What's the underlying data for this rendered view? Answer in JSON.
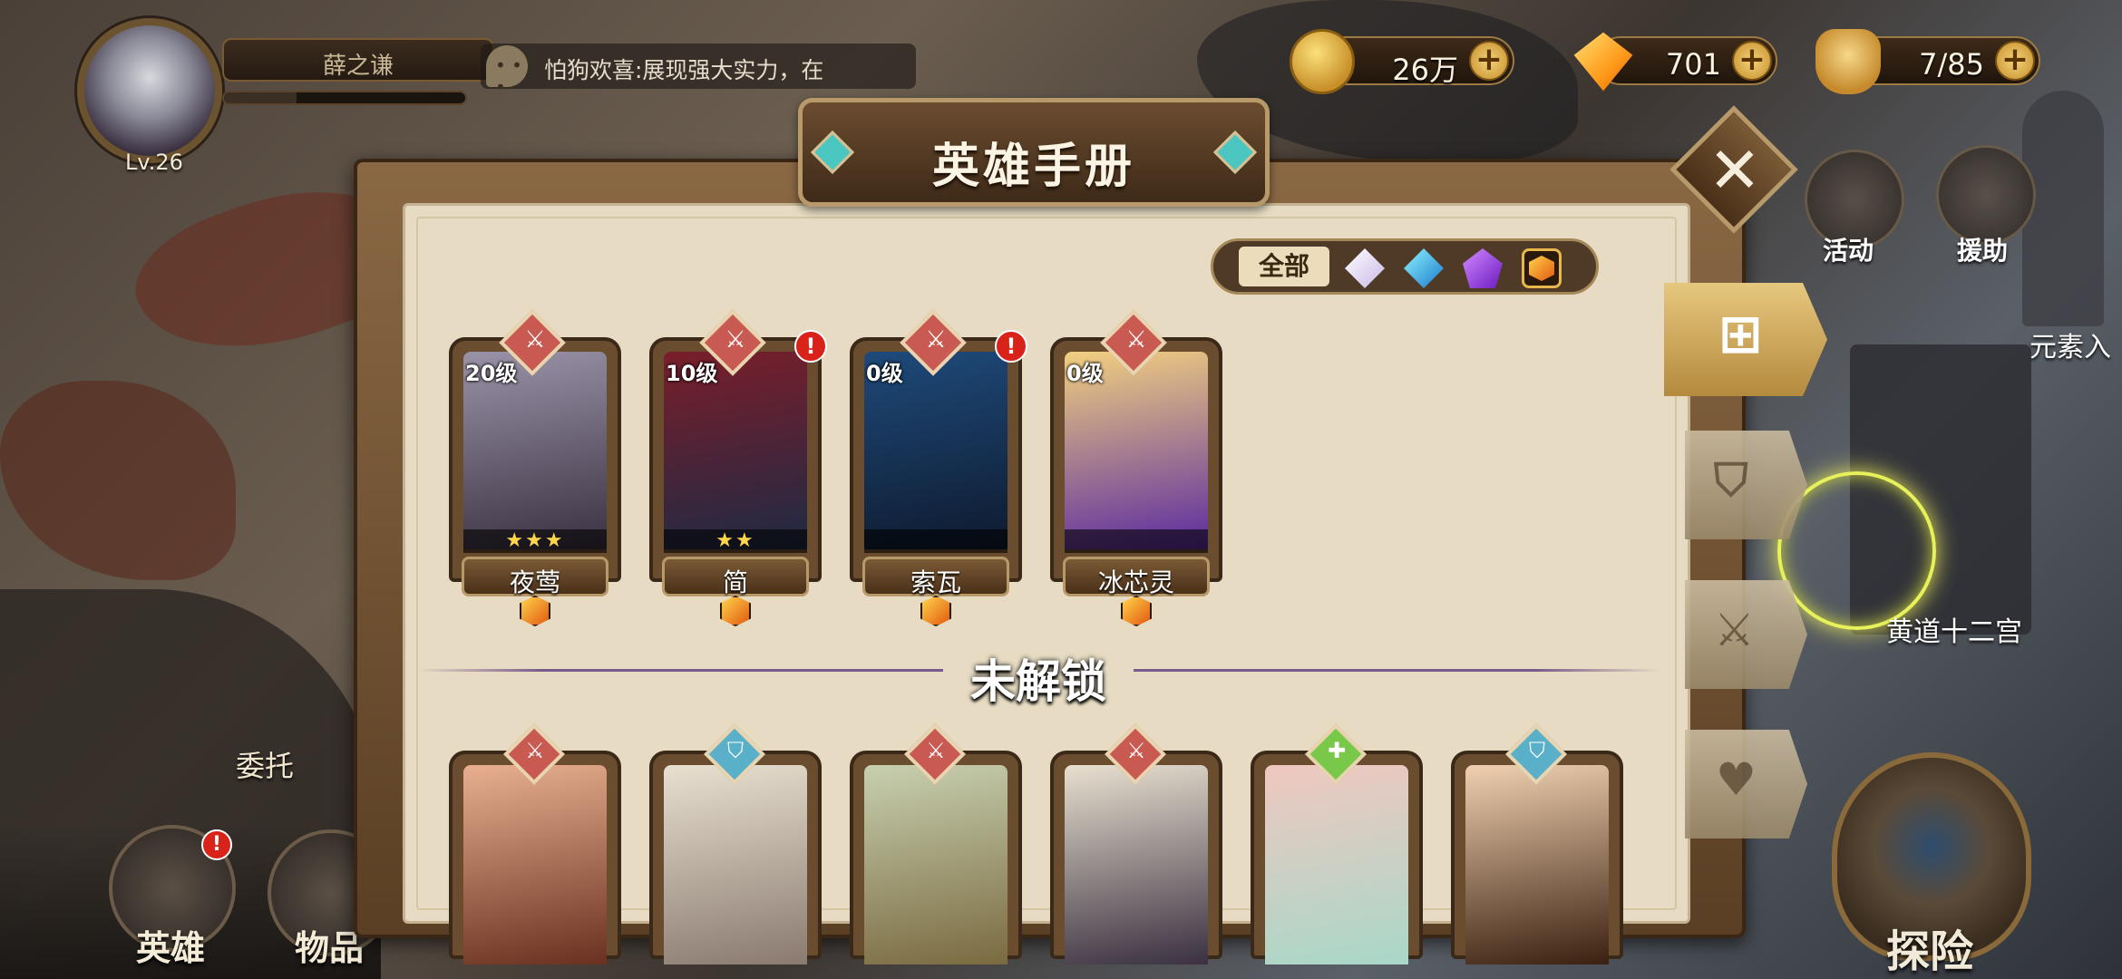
{
  "player": {
    "name": "薛之谦",
    "level": "Lv.26",
    "xp_fraction": 0.3
  },
  "chat": {
    "text": "怕狗欢喜:展现强大实力，在"
  },
  "currencies": [
    {
      "id": "gold",
      "icon": "gold-coin-icon",
      "value": "26万"
    },
    {
      "id": "gem",
      "icon": "diamond-icon",
      "value": "701"
    },
    {
      "id": "stamina",
      "icon": "stamina-bag-icon",
      "value": "7/85"
    }
  ],
  "right_menu": {
    "activity": "活动",
    "assist": "援助",
    "element": "元素入",
    "zodiac": "黄道十二宫",
    "explore": "探险"
  },
  "bottom_nav": {
    "hero": "英雄",
    "hero_badge": "!",
    "items": "物品",
    "entrust": "委托"
  },
  "modal": {
    "title": "英雄手册",
    "close_label": "✕",
    "filter": {
      "all": "全部",
      "gems": [
        "light-gem-icon",
        "water-gem-icon",
        "dark-gem-icon",
        "fire-gem-icon"
      ]
    },
    "tabs": [
      "all-heroes-icon",
      "shield-icon",
      "sword-icon",
      "heart-icon"
    ],
    "owned_heroes": [
      {
        "name": "夜莺",
        "level": "20级",
        "stars": "★★★",
        "class": "sword",
        "alert": "",
        "colors": [
          "#9a93a8",
          "#3a3040"
        ]
      },
      {
        "name": "简",
        "level": "10级",
        "stars": "★★",
        "class": "sword",
        "alert": "!",
        "colors": [
          "#7a1e2a",
          "#1e2a44"
        ]
      },
      {
        "name": "索瓦",
        "level": "0级",
        "stars": "",
        "class": "sword",
        "alert": "!",
        "colors": [
          "#1e4a7a",
          "#0e1a2e"
        ]
      },
      {
        "name": "冰芯灵",
        "level": "0级",
        "stars": "",
        "class": "sword",
        "alert": "",
        "colors": [
          "#f2d080",
          "#5a2aa0"
        ]
      }
    ],
    "locked_title": "未解锁",
    "locked_heroes": [
      {
        "class": "sword",
        "class_color": "#c95a52",
        "colors": [
          "#e8b090",
          "#6a3020"
        ]
      },
      {
        "class": "shield",
        "class_color": "#5ab0c8",
        "colors": [
          "#e8e0d0",
          "#8a7a70"
        ]
      },
      {
        "class": "sword",
        "class_color": "#c95a52",
        "colors": [
          "#c8d0b0",
          "#7a6a40"
        ]
      },
      {
        "class": "sword",
        "class_color": "#c95a52",
        "colors": [
          "#e8e0d0",
          "#3a3040"
        ]
      },
      {
        "class": "heal",
        "class_color": "#7ac84a",
        "colors": [
          "#f0c8c0",
          "#a8d8c8"
        ]
      },
      {
        "class": "shield",
        "class_color": "#5ab0c8",
        "colors": [
          "#f0d0b0",
          "#3a2010"
        ]
      }
    ]
  }
}
